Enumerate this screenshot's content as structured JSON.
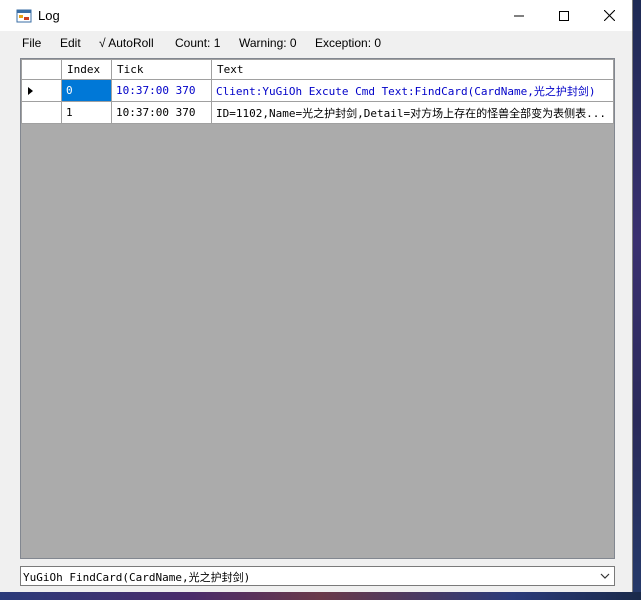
{
  "window": {
    "title": "Log",
    "icon": "app-window-icon",
    "controls": [
      "minimize-icon",
      "maximize-icon",
      "close-icon"
    ]
  },
  "menu": {
    "file": "File",
    "edit": "Edit",
    "autoroll": "√ AutoRoll",
    "count": "Count: 1",
    "warning": "Warning: 0",
    "exception": "Exception: 0"
  },
  "grid": {
    "columns": [
      "Index",
      "Tick",
      "Text"
    ],
    "rows": [
      {
        "index": "0",
        "tick": "10:37:00 370",
        "text": "Client:YuGiOh Excute Cmd Text:FindCard(CardName,光之护封剑)",
        "current": true,
        "text_color": "#0000c8"
      },
      {
        "index": "1",
        "tick": "10:37:00 370",
        "text": "ID=1102,Name=光之护封剑,Detail=对方场上存在的怪兽全部变为表侧表...",
        "current": false,
        "text_color": "#000000"
      }
    ],
    "selection_color": "#0078d7"
  },
  "command_box": {
    "value": "YuGiOh FindCard(CardName,光之护封剑)",
    "icon": "chevron-down-icon"
  }
}
